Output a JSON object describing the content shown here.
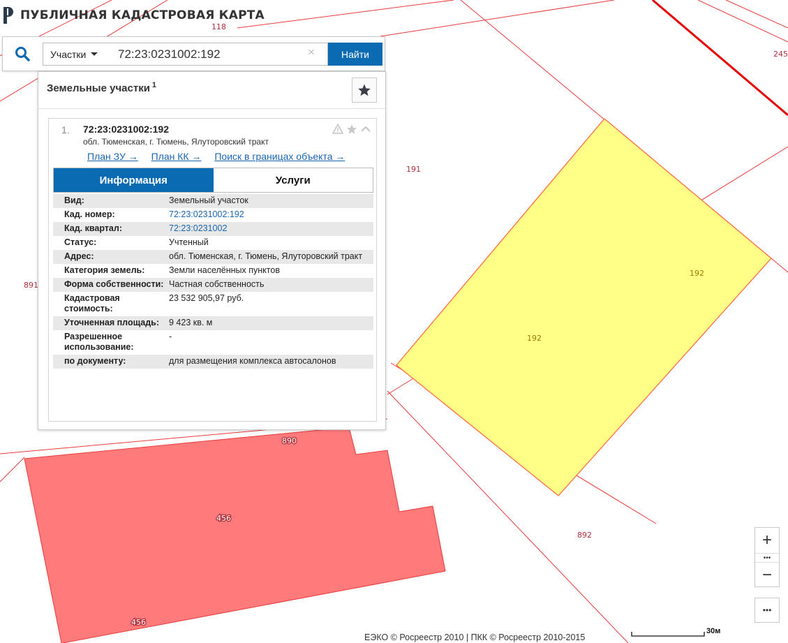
{
  "app": {
    "title": "ПУБЛИЧНАЯ КАДАСТРОВАЯ КАРТА"
  },
  "search": {
    "type_label": "Участки",
    "query": "72:23:0231002:192",
    "clear_glyph": "×",
    "submit_label": "Найти"
  },
  "results": {
    "title": "Земельные участки",
    "count": "1",
    "item": {
      "index": "1.",
      "cad_number": "72:23:0231002:192",
      "address": "обл. Тюменская, г. Тюмень, Ялуторовский тракт",
      "links": [
        "План ЗУ →",
        "План КК →",
        "Поиск в границах объекта →"
      ],
      "tabs": [
        "Информация",
        "Услуги"
      ],
      "info": [
        {
          "label": "Вид:",
          "value": "Земельный участок"
        },
        {
          "label": "Кад. номер:",
          "value": "72:23:0231002:192"
        },
        {
          "label": "Кад. квартал:",
          "value": "72:23:0231002"
        },
        {
          "label": "Статус:",
          "value": "Учтенный"
        },
        {
          "label": "Адрес:",
          "value": "обл. Тюменская, г. Тюмень, Ялуторовский тракт"
        },
        {
          "label": "Категория земель:",
          "value": "Земли населённых пунктов"
        },
        {
          "label": "Форма собственности:",
          "value": "Частная собственность"
        },
        {
          "label": "Кадастровая стоимость:",
          "value": "23 532 905,97 руб."
        },
        {
          "label": "Уточненная площадь:",
          "value": "9 423 кв. м"
        },
        {
          "label": "Разрешенное использование:",
          "value": "-"
        },
        {
          "label": "по документу:",
          "value": "для размещения комплекса автосалонов"
        }
      ]
    }
  },
  "map": {
    "labels": [
      "118",
      "245",
      "191",
      "192",
      "192",
      "891",
      "890",
      "456",
      "456",
      "892"
    ],
    "colors": {
      "selected_fill": "#ffff88",
      "selected_stroke": "#ff6e40",
      "building_fill": "#ff7b7b",
      "boundary": "#e83a3a"
    }
  },
  "controls": {
    "zoom_in": "+",
    "zoom_out": "−",
    "zoom_dots": "•••",
    "more": "•••"
  },
  "footer": {
    "copyright": "ЕЭКО © Росреестр 2010 | ПКК © Росреестр 2010-2015",
    "scale_label": "30м"
  }
}
